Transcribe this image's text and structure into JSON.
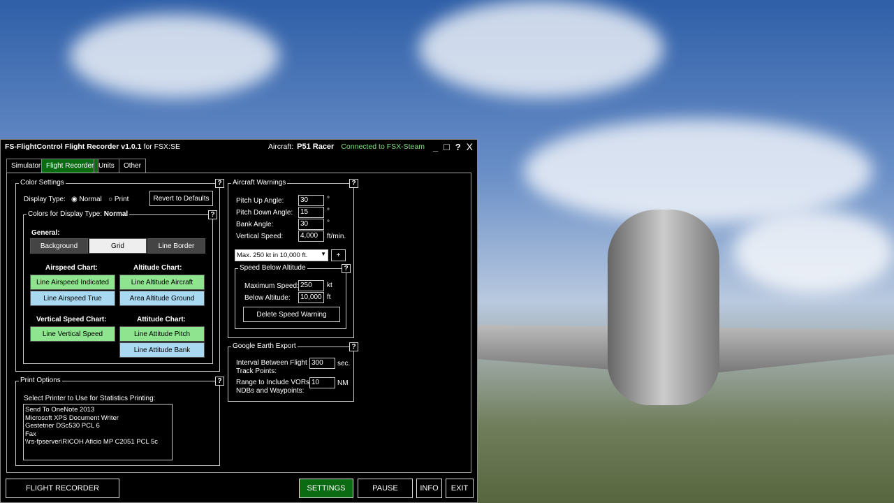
{
  "window": {
    "title": "FS-FlightControl Flight Recorder v1.0.1",
    "title_suffix": "for FSX:SE",
    "aircraft_label": "Aircraft:",
    "aircraft": "P51 Racer",
    "connection": "Connected to FSX-Steam",
    "controls": {
      "minimize": "_",
      "maximize": "□",
      "help": "?",
      "close": "X"
    }
  },
  "tabs": [
    {
      "label": "Simulator"
    },
    {
      "label": "Flight Recorder",
      "active": true
    },
    {
      "label": "Units"
    },
    {
      "label": "Other"
    }
  ],
  "color_settings": {
    "title": "Color Settings",
    "display_type_label": "Display Type:",
    "options": [
      "Normal",
      "Print"
    ],
    "selected": "Normal",
    "revert": "Revert to Defaults",
    "colors_for_label": "Colors for Display Type:",
    "colors_for_value": "Normal",
    "general": "General:",
    "general_buttons": [
      "Background",
      "Grid",
      "Line Border"
    ],
    "airspeed_chart": "Airspeed Chart:",
    "airspeed_buttons": [
      "Line Airspeed Indicated",
      "Line Airspeed True"
    ],
    "altitude_chart": "Altitude Chart:",
    "altitude_buttons": [
      "Line Altitude Aircraft",
      "Area Altitude Ground"
    ],
    "vs_chart": "Vertical Speed Chart:",
    "vs_buttons": [
      "Line Vertical Speed"
    ],
    "attitude_chart": "Attitude Chart:",
    "attitude_buttons": [
      "Line Attitude Pitch",
      "Line Attitude Bank"
    ]
  },
  "print_options": {
    "title": "Print Options",
    "label": "Select Printer to Use for Statistics Printing:",
    "printers": [
      "Send To OneNote 2013",
      "Microsoft XPS Document Writer",
      "Gestetner DSc530 PCL 6",
      "Fax",
      "\\\\rs-fpserver\\RICOH Aficio MP C2051 PCL 5c"
    ]
  },
  "aircraft_warnings": {
    "title": "Aircraft Warnings",
    "pitch_up_label": "Pitch Up Angle:",
    "pitch_up": "30",
    "pitch_down_label": "Pitch Down Angle:",
    "pitch_down": "15",
    "bank_label": "Bank Angle:",
    "bank": "30",
    "deg": "°",
    "vs_label": "Vertical Speed:",
    "vs": "4,000",
    "vs_unit": "ft/min.",
    "speed_warning_select": "Max. 250 kt in 10,000 ft.",
    "add": "+",
    "speed_below": {
      "title": "Speed Below Altitude",
      "max_label": "Maximum Speed:",
      "max": "250",
      "max_unit": "kt",
      "alt_label": "Below Altitude:",
      "alt": "10,000",
      "alt_unit": "ft",
      "delete": "Delete Speed Warning"
    }
  },
  "google_earth": {
    "title": "Google Earth Export",
    "interval_label": "Interval Between Flight Track Points:",
    "interval": "300",
    "interval_unit": "sec.",
    "range_label": "Range to Include VORs, NDBs and Waypoints:",
    "range": "10",
    "range_unit": "NM"
  },
  "bottom": {
    "mode": "FLIGHT RECORDER",
    "settings": "SETTINGS",
    "pause": "PAUSE",
    "info": "INFO",
    "exit": "EXIT"
  },
  "colors": {
    "accent": "#0b6b12",
    "connected": "#7fe07f",
    "green_button": "#8fe58f",
    "blue_button": "#a9d9f0"
  }
}
